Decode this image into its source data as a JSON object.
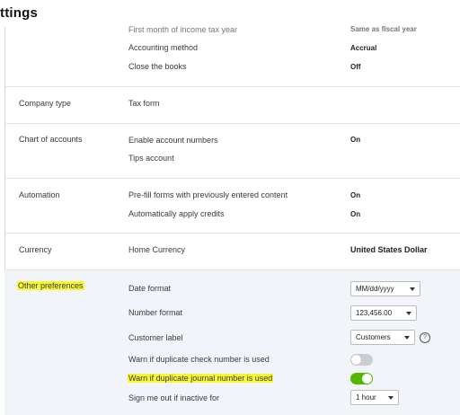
{
  "page": {
    "title": "ttings"
  },
  "accounting_section": {
    "rows": [
      {
        "label": "First month of income tax year",
        "value": "Same as fiscal year"
      },
      {
        "label": "Accounting method",
        "value": "Accrual"
      },
      {
        "label": "Close the books",
        "value": "Off"
      }
    ]
  },
  "company_type": {
    "section_label": "Company type",
    "rows": [
      {
        "label": "Tax form"
      }
    ]
  },
  "chart_of_accounts": {
    "section_label": "Chart of accounts",
    "rows": [
      {
        "label": "Enable account numbers",
        "value": "On"
      },
      {
        "label": "Tips account"
      }
    ]
  },
  "automation": {
    "section_label": "Automation",
    "rows": [
      {
        "label": "Pre-fill forms with previously entered content",
        "value": "On"
      },
      {
        "label": "Automatically apply credits",
        "value": "On"
      }
    ]
  },
  "currency": {
    "section_label": "Currency",
    "rows": [
      {
        "label": "Home Currency",
        "value": "United States Dollar"
      }
    ]
  },
  "other_preferences": {
    "section_label": "Other preferences",
    "date_format": {
      "label": "Date format",
      "value": "MM/dd/yyyy"
    },
    "number_format": {
      "label": "Number format",
      "value": "123,456.00"
    },
    "customer_label": {
      "label": "Customer label",
      "value": "Customers",
      "help": "?"
    },
    "warn_check": {
      "label": "Warn if duplicate check number is used",
      "state": "off"
    },
    "warn_journal": {
      "label": "Warn if duplicate journal number is used",
      "state": "on"
    },
    "sign_out": {
      "label": "Sign me out if inactive for",
      "value": "1 hour"
    }
  },
  "colors": {
    "highlight": "#f7f734",
    "toggle_on": "#53b700",
    "toggle_off": "#c9ccd1",
    "section_bg": "#f1f5fa"
  }
}
